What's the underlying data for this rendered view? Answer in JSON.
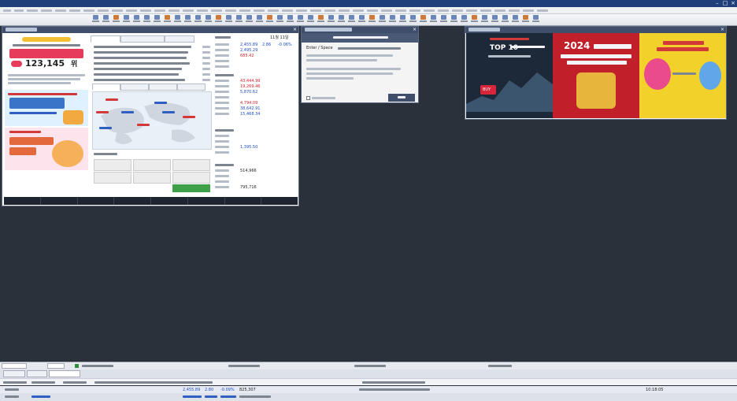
{
  "mini_window": {
    "title": "",
    "time": "11월 11일"
  },
  "rank_banner": {
    "number": "123,145",
    "unit": "위"
  },
  "market_indices": {
    "rows": [
      {
        "value": "2,455.89",
        "change": "2.86",
        "rate": "-0.06%",
        "dir": "down"
      },
      {
        "value": "2,495.29",
        "change": "",
        "rate": "",
        "dir": "down"
      },
      {
        "value": "685.42",
        "change": "",
        "rate": "",
        "dir": "up"
      },
      {
        "value": "",
        "change": "",
        "rate": "",
        "dir": "down"
      },
      {
        "value": "",
        "change": "",
        "rate": "",
        "dir": "down"
      }
    ],
    "overseas": [
      {
        "value": "43,444.99",
        "change": "",
        "rate": "",
        "dir": "up"
      },
      {
        "value": "19,269.46",
        "change": "",
        "rate": "",
        "dir": "up"
      },
      {
        "value": "5,870.62",
        "change": "",
        "rate": "",
        "dir": "down"
      },
      {
        "value": "",
        "change": "",
        "rate": "",
        "dir": "down"
      },
      {
        "value": "4,794.09",
        "change": "",
        "rate": "",
        "dir": "up"
      },
      {
        "value": "38,642.91",
        "change": "",
        "rate": "",
        "dir": "down"
      },
      {
        "value": "15,468.34",
        "change": "",
        "rate": "",
        "dir": "down"
      }
    ],
    "rates": [
      {
        "value": "",
        "change": "",
        "rate": "",
        "dir": "up"
      },
      {
        "value": "",
        "change": "",
        "rate": "",
        "dir": "down"
      },
      {
        "value": "1,395.50",
        "change": "",
        "rate": "",
        "dir": "down"
      },
      {
        "value": "",
        "change": "",
        "rate": "",
        "dir": "up"
      }
    ],
    "funds": [
      {
        "value": "514,966",
        "change": "",
        "rate": ""
      },
      {
        "value": "",
        "change": "",
        "rate": ""
      },
      {
        "value": "",
        "change": "",
        "rate": ""
      },
      {
        "value": "795,716",
        "change": "",
        "rate": ""
      }
    ]
  },
  "notice_dialog": {
    "title": "",
    "heading": "",
    "lead": "Enter / Space",
    "confirm_button": ""
  },
  "popup_window": {
    "title": "",
    "ad1_title": "TOP 10",
    "ad1_sub": "",
    "ad1_button": "BUY",
    "ad2_title": "2024",
    "ad2_sub": ""
  },
  "bottom_status": {
    "index1_value": "2,455.89",
    "index1_change": "2.80",
    "index1_rate": "-0.09%",
    "index1_volume": "825,307",
    "index2_value": "",
    "index2_change": "",
    "index2_rate": "",
    "time": "10:18:05"
  },
  "colors": {
    "up": "#d2232a",
    "down": "#1f4fc4",
    "title_bar": "#1f3f7a",
    "workspace": "#2b313a"
  }
}
